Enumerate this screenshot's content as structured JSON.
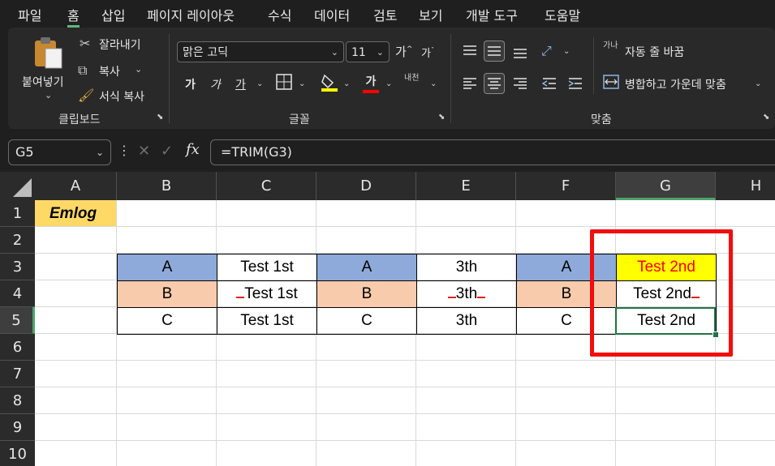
{
  "menu": [
    "파일",
    "홈",
    "삽입",
    "페이지 레이아웃",
    "수식",
    "데이터",
    "검토",
    "보기",
    "개발 도구",
    "도움말"
  ],
  "ribbon": {
    "clipboard": {
      "paste": "붙여넣기",
      "cut": "잘라내기",
      "copy": "복사",
      "format_painter": "서식 복사",
      "group": "클립보드"
    },
    "font": {
      "name": "맑은 고딕",
      "size": "11",
      "group": "글꼴",
      "bold": "가",
      "italic": "가",
      "underline": "가",
      "color_glyph": "가",
      "phonetic": "내천"
    },
    "alignment": {
      "wrap": "자동 줄 바꿈",
      "merge": "병합하고 가운데 맞춤",
      "group": "맞춤",
      "wrap_glyph": "가나"
    },
    "colors": {
      "highlight": "#ffff00",
      "font_color": "#ff0000"
    }
  },
  "formula_bar": {
    "name_box": "G5",
    "formula": "=TRIM(G3)",
    "fx": "fx",
    "cancel": "✕",
    "enter": "✓"
  },
  "sheet": {
    "columns": [
      "A",
      "B",
      "C",
      "D",
      "E",
      "F",
      "G",
      "H"
    ],
    "rows": [
      "1",
      "2",
      "3",
      "4",
      "5",
      "6",
      "7",
      "8",
      "9",
      "10"
    ],
    "A1": "Emlog",
    "row3": [
      "A",
      "Test 1st",
      "A",
      "3th",
      "A",
      "Test 2nd"
    ],
    "row4": [
      "B",
      "Test 1st",
      "B",
      "3th",
      "B",
      "Test 2nd"
    ],
    "row5": [
      "C",
      "Test 1st",
      "C",
      "3th",
      "C",
      "Test 2nd"
    ],
    "selected_cell": "G5"
  }
}
